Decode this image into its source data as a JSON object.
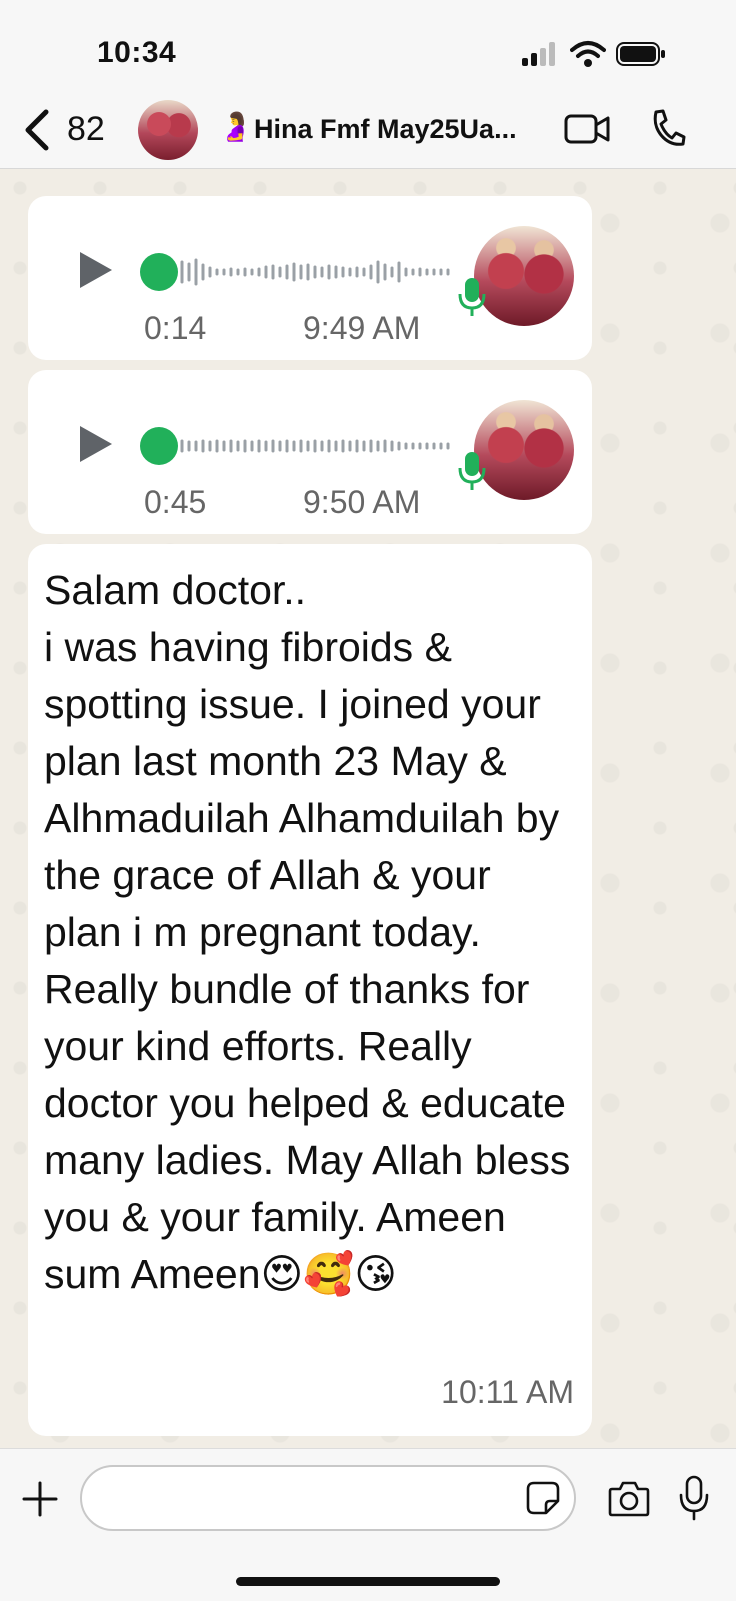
{
  "status_bar": {
    "time": "10:34"
  },
  "header": {
    "back_count": "82",
    "chat_emoji": "🤰",
    "chat_name": "Hina Fmf May25Ua..."
  },
  "messages": [
    {
      "type": "voice",
      "duration": "0:14",
      "time": "9:49 AM"
    },
    {
      "type": "voice",
      "duration": "0:45",
      "time": "9:50 AM"
    },
    {
      "type": "text",
      "text": "Salam doctor..\ni was having fibroids & spotting issue. I joined your plan last month 23 May & Alhmaduilah Alhamduilah by the grace of Allah & your plan i m pregnant today. Really bundle of thanks for your kind efforts. Really doctor you helped & educate many ladies. May Allah bless you & your family. Ameen sum Ameen😍🥰😘",
      "time": "10:11 AM"
    }
  ],
  "input": {
    "placeholder": ""
  },
  "colors": {
    "accent_green": "#21b05a",
    "bubble_bg": "#ffffff",
    "chat_bg": "#efeae2"
  },
  "icons": [
    "back-chevron-icon",
    "video-call-icon",
    "phone-icon",
    "play-icon",
    "mic-icon",
    "plus-icon",
    "sticker-icon",
    "camera-icon"
  ]
}
